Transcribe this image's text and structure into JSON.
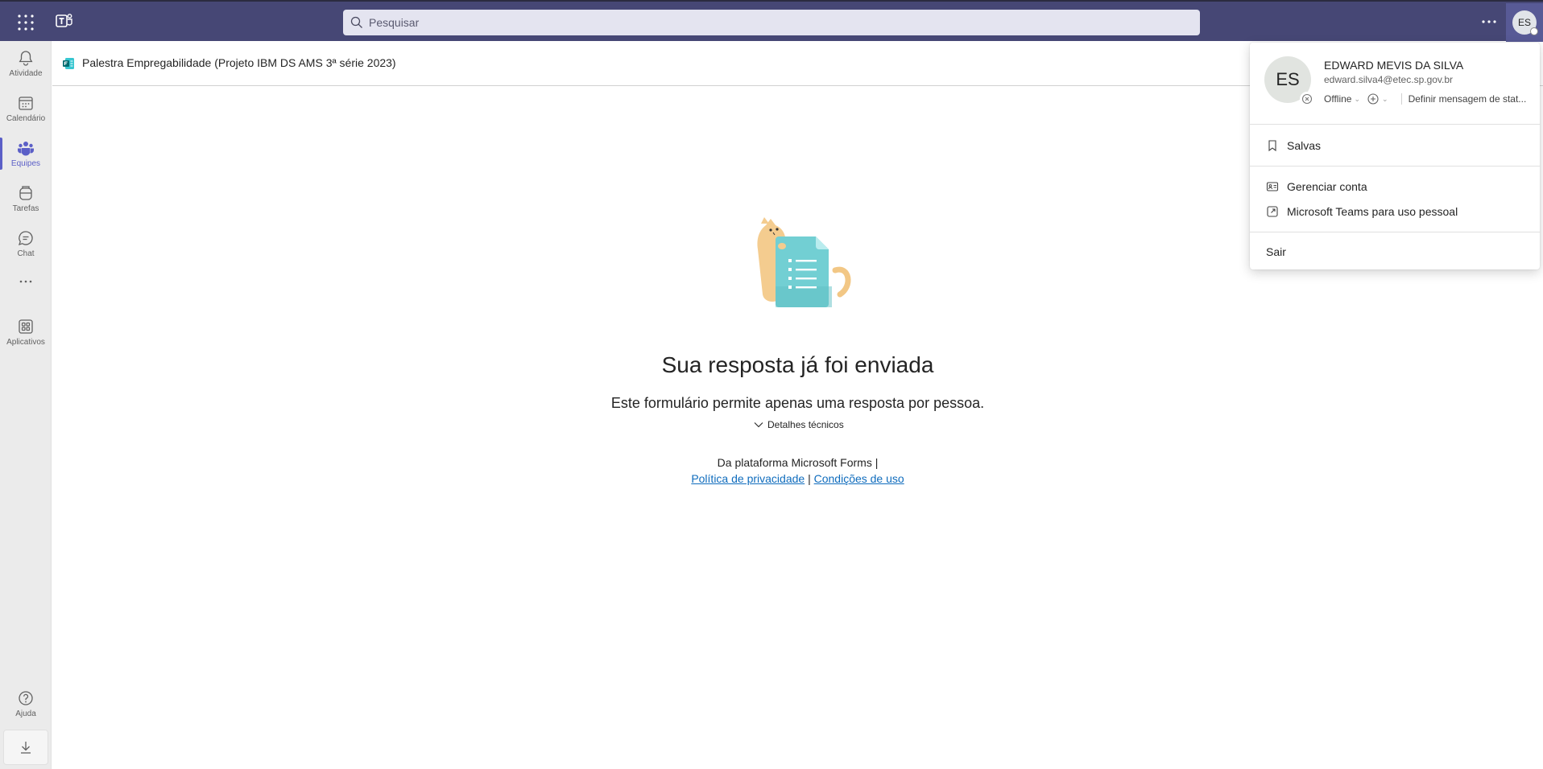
{
  "topbar": {
    "search_placeholder": "Pesquisar",
    "avatar_initials": "ES",
    "accent": "#464775"
  },
  "rail": {
    "items": [
      {
        "label": "Atividade",
        "icon": "bell-icon"
      },
      {
        "label": "Calendário",
        "icon": "calendar-icon"
      },
      {
        "label": "Equipes",
        "icon": "teams-icon",
        "active": true
      },
      {
        "label": "Tarefas",
        "icon": "tasks-icon"
      },
      {
        "label": "Chat",
        "icon": "chat-icon"
      },
      {
        "label": "Aplicativos",
        "icon": "apps-icon"
      },
      {
        "label": "Ajuda",
        "icon": "help-icon"
      }
    ],
    "active_color": "#5b5fc7"
  },
  "header": {
    "title": "Palestra Empregabilidade (Projeto IBM DS AMS 3ª série 2023)"
  },
  "content": {
    "title": "Sua resposta já foi enviada",
    "subtitle": "Este formulário permite apenas uma resposta por pessoa.",
    "details_label": "Detalhes técnicos",
    "footer_line1": "Da plataforma Microsoft Forms |",
    "privacy_link": "Política de privacidade",
    "separator": "|",
    "terms_link": "Condições de uso",
    "link_color": "#0f6cbd"
  },
  "profile": {
    "initials": "ES",
    "name": "EDWARD MEVIS DA SILVA",
    "email": "edward.silva4@etec.sp.gov.br",
    "status": "Offline",
    "status_message": "Definir mensagem de stat...",
    "menu": {
      "saved": "Salvas",
      "manage_account": "Gerenciar conta",
      "personal_teams": "Microsoft Teams para uso pessoal",
      "sign_out": "Sair"
    }
  }
}
